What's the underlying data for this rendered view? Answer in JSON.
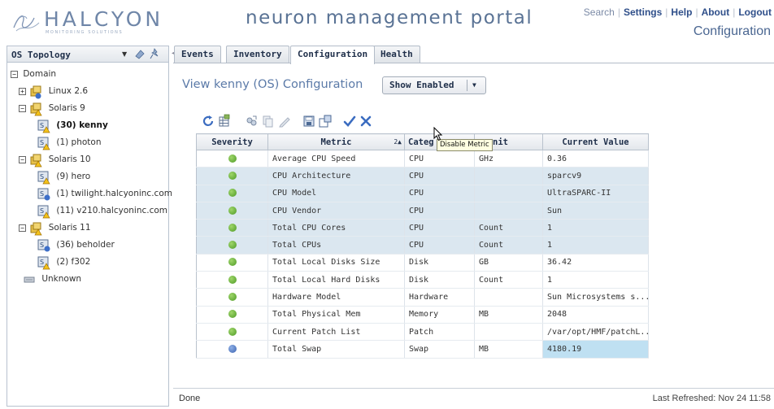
{
  "header": {
    "logo_name": "HALCYON",
    "logo_tagline": "MONITORING SOLUTIONS",
    "portal_title": "neuron management portal",
    "links": [
      "Search",
      "Settings",
      "Help",
      "About",
      "Logout"
    ],
    "section": "Configuration"
  },
  "left_panel": {
    "title": "OS Topology",
    "tree": [
      {
        "label": "Domain",
        "expander": "−"
      },
      {
        "label": "Linux 2.6",
        "expander": "+"
      },
      {
        "label": "Solaris 9",
        "expander": "−"
      },
      {
        "label": "(30) kenny",
        "selected": true
      },
      {
        "label": "(1) photon"
      },
      {
        "label": "Solaris 10",
        "expander": "−"
      },
      {
        "label": "(9) hero"
      },
      {
        "label": "(1) twilight.halcyoninc.com"
      },
      {
        "label": "(11) v210.halcyoninc.com"
      },
      {
        "label": "Solaris 11",
        "expander": "−"
      },
      {
        "label": "(36) beholder"
      },
      {
        "label": "(2) f302"
      },
      {
        "label": "Unknown"
      }
    ]
  },
  "tabs": [
    {
      "label": "Events"
    },
    {
      "label": "Inventory"
    },
    {
      "label": "Configuration",
      "active": true
    },
    {
      "label": "Health"
    }
  ],
  "main": {
    "view_title": "View kenny (OS) Configuration",
    "show_select": {
      "value": "Show Enabled"
    },
    "tooltip": "Disable Metric"
  },
  "grid": {
    "columns": [
      "Severity",
      "Metric",
      "Category",
      "Unit",
      "Current Value"
    ],
    "visible_header_text": [
      "Severity",
      "Metric",
      "Categ",
      "nit",
      "Current Value"
    ],
    "sort_indicator": "2▲",
    "rows": [
      {
        "severity": "ok",
        "metric": "Average CPU Speed",
        "category": "CPU",
        "unit": "GHz",
        "value": "0.36",
        "highlight": false
      },
      {
        "severity": "ok",
        "metric": "CPU Architecture",
        "category": "CPU",
        "unit": "",
        "value": "sparcv9",
        "highlight": true
      },
      {
        "severity": "ok",
        "metric": "CPU Model",
        "category": "CPU",
        "unit": "",
        "value": "UltraSPARC-II",
        "highlight": true
      },
      {
        "severity": "ok",
        "metric": "CPU Vendor",
        "category": "CPU",
        "unit": "",
        "value": "Sun",
        "highlight": true
      },
      {
        "severity": "ok",
        "metric": "Total CPU Cores",
        "category": "CPU",
        "unit": "Count",
        "value": "1",
        "highlight": true
      },
      {
        "severity": "ok",
        "metric": "Total CPUs",
        "category": "CPU",
        "unit": "Count",
        "value": "1",
        "highlight": true
      },
      {
        "severity": "ok",
        "metric": "Total Local Disks Size",
        "category": "Disk",
        "unit": "GB",
        "value": "36.42",
        "highlight": false
      },
      {
        "severity": "ok",
        "metric": "Total Local Hard Disks",
        "category": "Disk",
        "unit": "Count",
        "value": "1",
        "highlight": false
      },
      {
        "severity": "ok",
        "metric": "Hardware Model",
        "category": "Hardware",
        "unit": "",
        "value": "Sun Microsystems s...",
        "highlight": false
      },
      {
        "severity": "ok",
        "metric": "Total Physical Mem",
        "category": "Memory",
        "unit": "MB",
        "value": "2048",
        "highlight": false
      },
      {
        "severity": "ok",
        "metric": "Current Patch List",
        "category": "Patch",
        "unit": "",
        "value": "/var/opt/HMF/patchL...",
        "highlight": false
      },
      {
        "severity": "info",
        "metric": "Total Swap",
        "category": "Swap",
        "unit": "MB",
        "value": "4180.19",
        "highlight": false,
        "value_selected": true
      }
    ]
  },
  "status": {
    "left": "Done",
    "right": "Last Refreshed: Nov 24 11:58"
  }
}
